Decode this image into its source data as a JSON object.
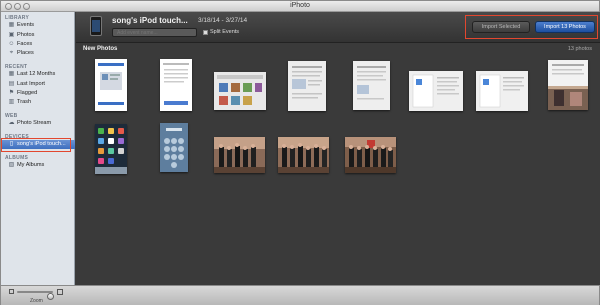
{
  "window": {
    "title": "iPhoto"
  },
  "sidebar": {
    "library": {
      "header": "LIBRARY",
      "items": [
        {
          "label": "Events",
          "icon": "events-icon",
          "glyph": "▦"
        },
        {
          "label": "Photos",
          "icon": "photos-icon",
          "glyph": "▣"
        },
        {
          "label": "Faces",
          "icon": "faces-icon",
          "glyph": "☺"
        },
        {
          "label": "Places",
          "icon": "places-icon",
          "glyph": "⌖"
        }
      ]
    },
    "recent": {
      "header": "RECENT",
      "items": [
        {
          "label": "Last 12 Months",
          "icon": "calendar-icon",
          "glyph": "▦"
        },
        {
          "label": "Last Import",
          "icon": "import-icon",
          "glyph": "▤"
        },
        {
          "label": "Flagged",
          "icon": "flag-icon",
          "glyph": "⚑"
        },
        {
          "label": "Trash",
          "icon": "trash-icon",
          "glyph": "▥"
        }
      ]
    },
    "web": {
      "header": "WEB",
      "items": [
        {
          "label": "Photo Stream",
          "icon": "cloud-icon",
          "glyph": "☁"
        }
      ]
    },
    "devices": {
      "header": "DEVICES",
      "items": [
        {
          "label": "song's iPod touch...",
          "icon": "ipod-icon",
          "glyph": "▯"
        }
      ]
    },
    "albums": {
      "header": "ALBUMS",
      "items": [
        {
          "label": "My Albums",
          "icon": "albums-icon",
          "glyph": "▧"
        }
      ]
    }
  },
  "header": {
    "device_name": "song's iPod touch...",
    "date_range": "3/18/14 - 3/27/14",
    "event_placeholder": "Add event name...",
    "split_events_label": "Split Events",
    "import_selected_label": "Import Selected",
    "import_all_label": "Import 13 Photos"
  },
  "content": {
    "section_title": "New Photos",
    "photo_count": "13 photos",
    "photos": [
      {
        "type": "phone-screen"
      },
      {
        "type": "phone-screen"
      },
      {
        "type": "screenshot"
      },
      {
        "type": "document"
      },
      {
        "type": "document"
      },
      {
        "type": "document"
      },
      {
        "type": "document"
      },
      {
        "type": "document-photo"
      },
      {
        "type": "homescreen"
      },
      {
        "type": "lockscreen"
      },
      {
        "type": "group-photo"
      },
      {
        "type": "group-photo"
      },
      {
        "type": "group-photo"
      }
    ]
  },
  "footer": {
    "zoom_label": "Zoom"
  },
  "colors": {
    "accent_blue": "#2b5fb4",
    "highlight_red": "#e2472f",
    "content_bg": "#3a3a3a",
    "sidebar_bg": "#dfe4ea"
  }
}
